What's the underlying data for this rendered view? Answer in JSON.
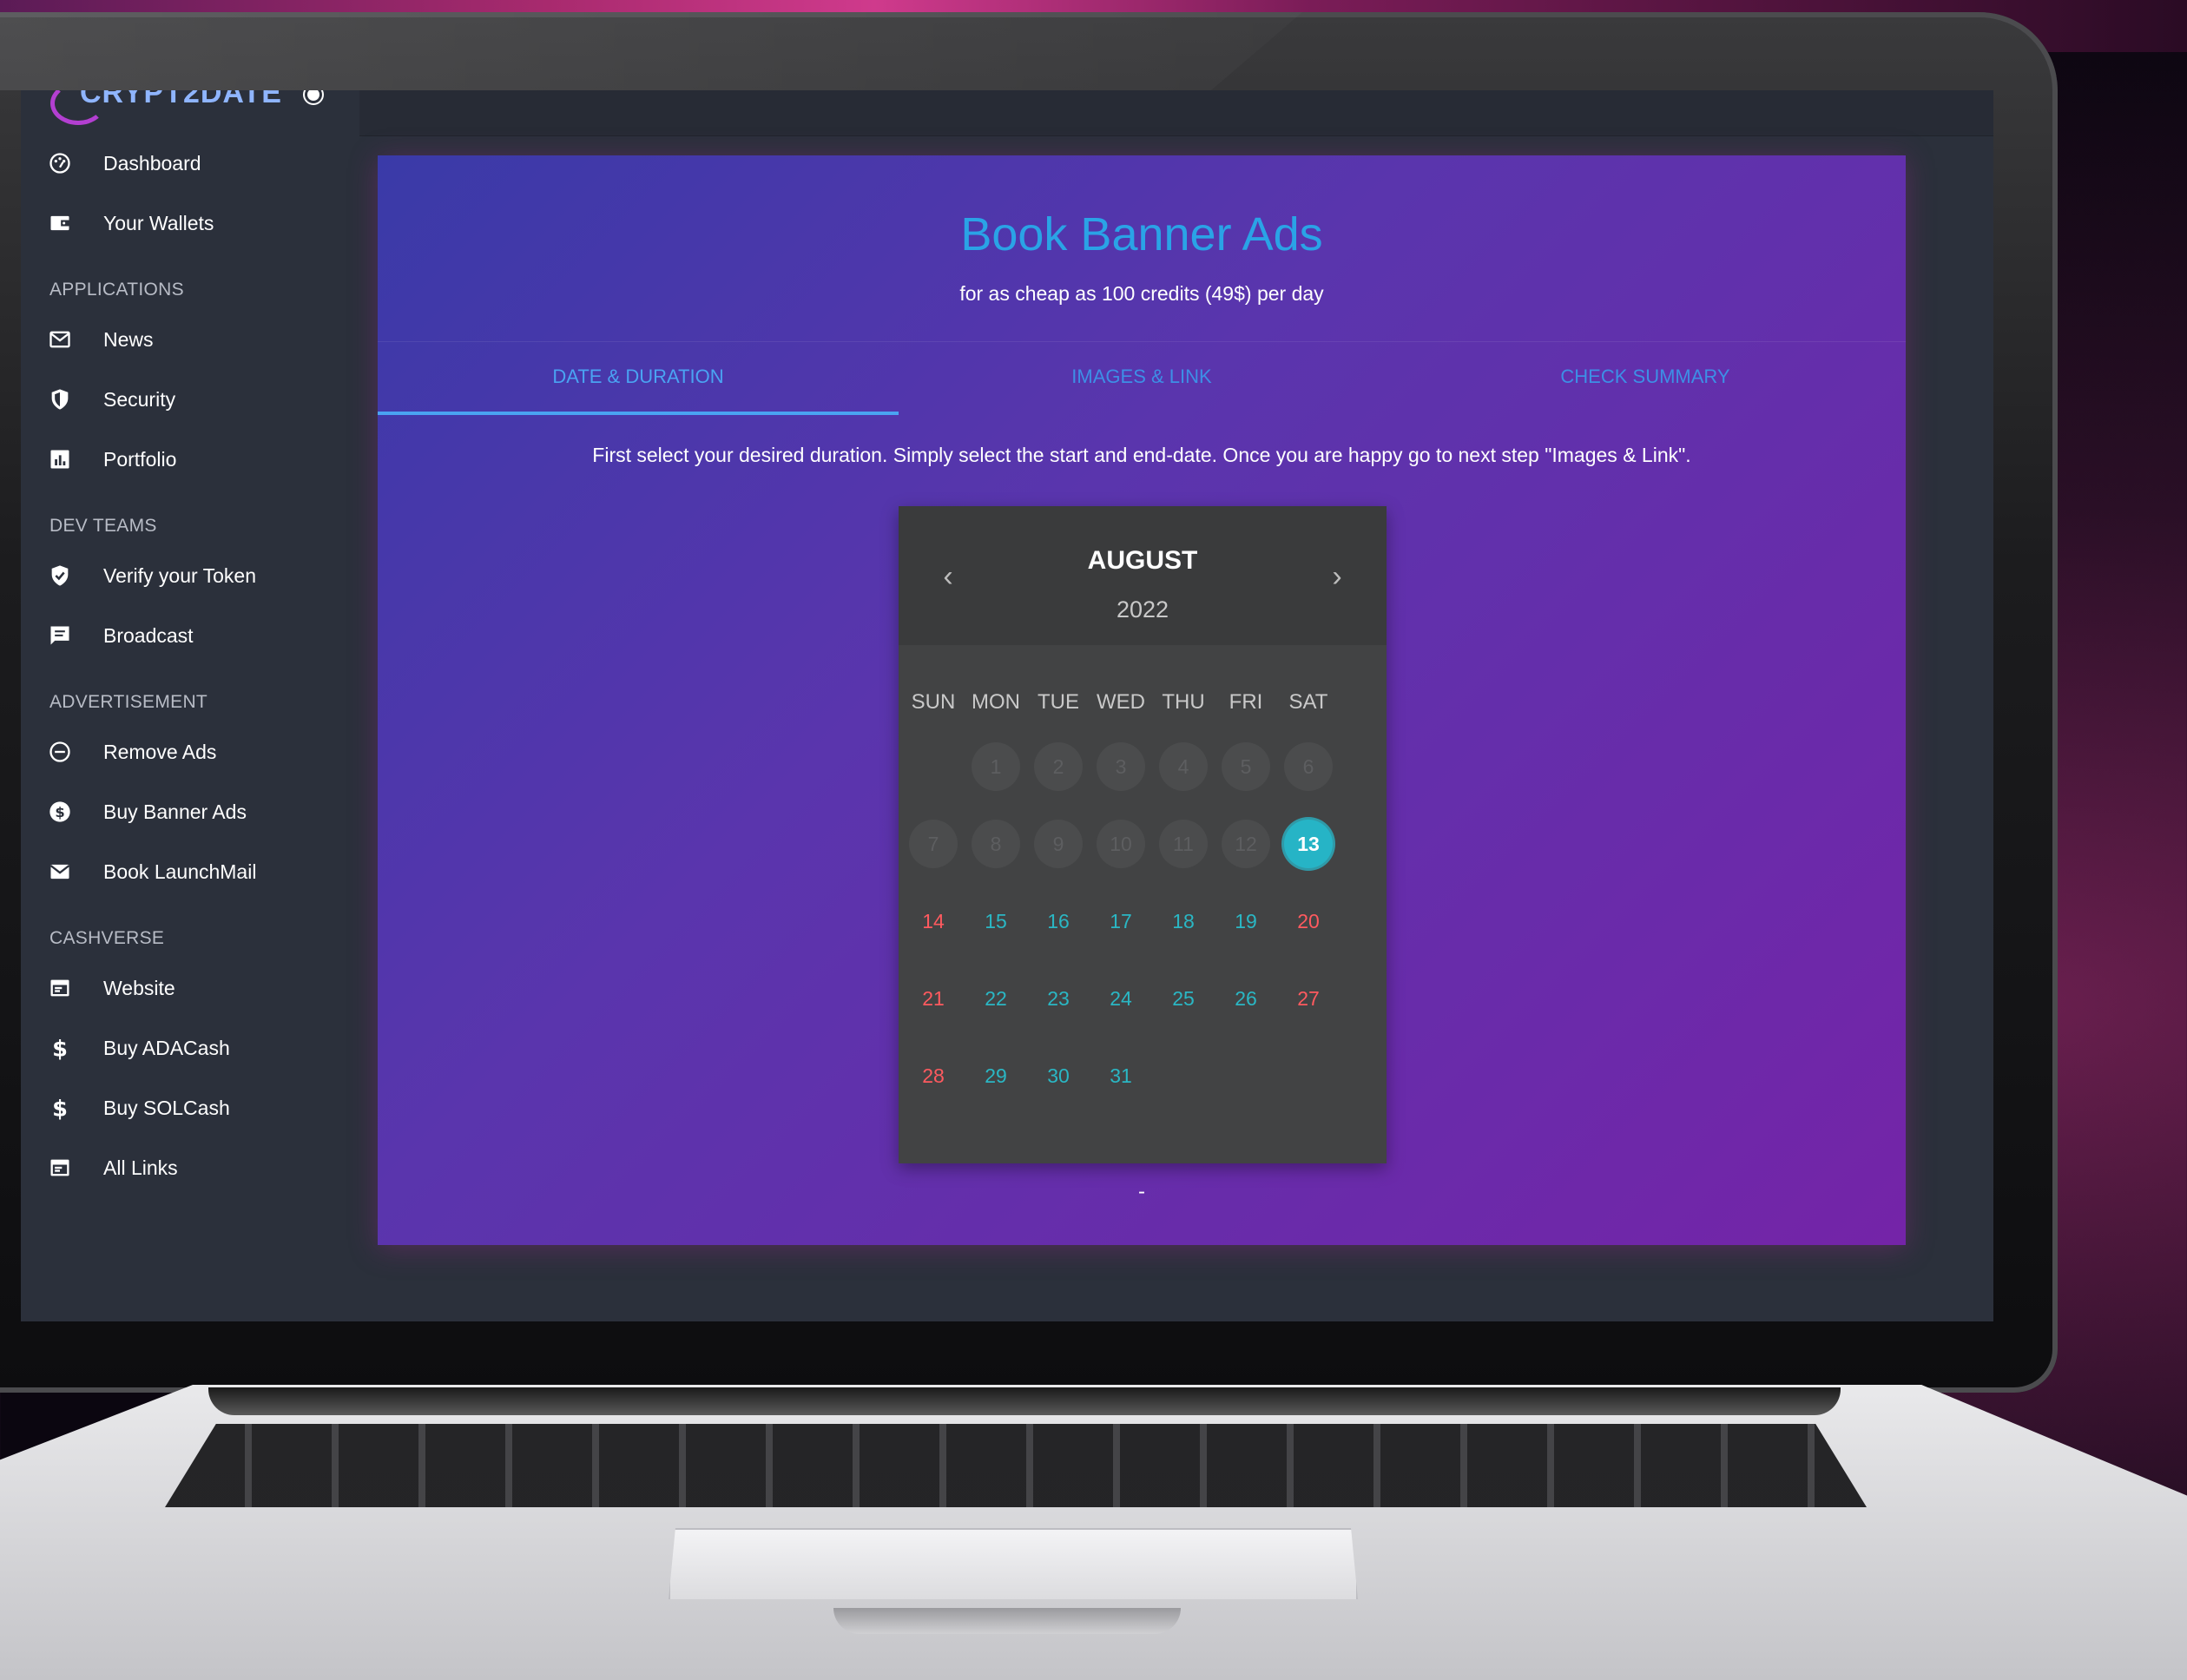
{
  "app": {
    "logo_text": "CRYPT2DATE"
  },
  "sidebar": {
    "items_top": [
      {
        "label": "Dashboard",
        "icon": "dashboard-icon"
      },
      {
        "label": "Your Wallets",
        "icon": "wallet-icon"
      }
    ],
    "sections": [
      {
        "title": "APPLICATIONS",
        "items": [
          {
            "label": "News",
            "icon": "mail-icon"
          },
          {
            "label": "Security",
            "icon": "shield-icon"
          },
          {
            "label": "Portfolio",
            "icon": "chart-icon"
          }
        ]
      },
      {
        "title": "DEV TEAMS",
        "items": [
          {
            "label": "Verify your Token",
            "icon": "verified-shield-icon"
          },
          {
            "label": "Broadcast",
            "icon": "message-icon"
          }
        ]
      },
      {
        "title": "ADVERTISEMENT",
        "items": [
          {
            "label": "Remove Ads",
            "icon": "minus-circle-icon"
          },
          {
            "label": "Buy Banner Ads",
            "icon": "dollar-circle-icon"
          },
          {
            "label": "Book LaunchMail",
            "icon": "envelope-icon"
          }
        ]
      },
      {
        "title": "CASHVERSE",
        "items": [
          {
            "label": "Website",
            "icon": "browser-icon"
          },
          {
            "label": "Buy ADACash",
            "icon": "dollar-icon"
          },
          {
            "label": "Buy SOLCash",
            "icon": "dollar-icon"
          },
          {
            "label": "All Links",
            "icon": "browser-icon"
          }
        ]
      }
    ]
  },
  "main": {
    "title": "Book Banner Ads",
    "subtitle": "for as cheap as 100 credits (49$) per day",
    "tabs": [
      {
        "label": "DATE & DURATION",
        "active": true
      },
      {
        "label": "IMAGES & LINK",
        "active": false
      },
      {
        "label": "CHECK SUMMARY",
        "active": false
      }
    ],
    "instruction": "First select your desired duration. Simply select the start and end-date. Once you are happy go to next step \"Images & Link\".",
    "date_range_text": "-"
  },
  "calendar": {
    "month": "AUGUST",
    "year": "2022",
    "prev_icon": "chevron-left-icon",
    "next_icon": "chevron-right-icon",
    "weekdays": [
      "SUN",
      "MON",
      "TUE",
      "WED",
      "THU",
      "FRI",
      "SAT"
    ],
    "first_weekday_index": 1,
    "days_in_month": 31,
    "disabled_before": 13,
    "selected": 13,
    "colors": {
      "selected": "#26b4c6",
      "weekday": "#2ab7c4",
      "weekend": "#ff5a5f"
    }
  }
}
